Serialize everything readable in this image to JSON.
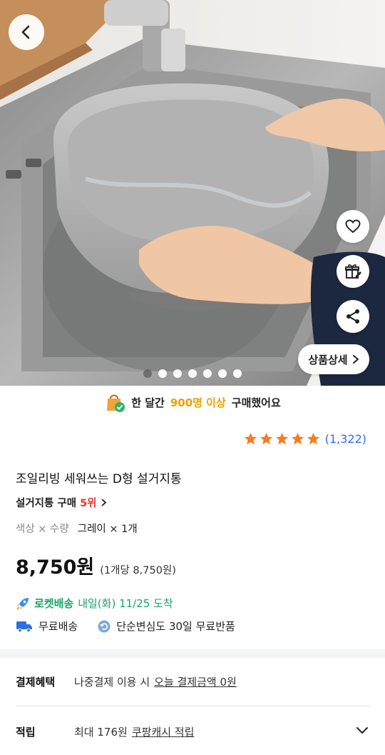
{
  "hero": {
    "total_images": 7,
    "active_index": 0,
    "detail_label": "상품상세"
  },
  "icons": {
    "back": "chevron-left-icon",
    "wishlist": "heart-icon",
    "gift": "gift-icon",
    "share": "share-icon",
    "detail": "chevron-right-icon"
  },
  "banner": {
    "pre": "한 달간",
    "count": "900명 이상",
    "post": "구매했어요"
  },
  "rating": {
    "stars": 5,
    "count_label": "(1,322)",
    "star_color": "#f57c20"
  },
  "product": {
    "title": "조일리빙 세워쓰는 D형 설거지통",
    "rank_label": "설거지통 구매",
    "rank_value": "5위",
    "option_label": "색상 × 수량",
    "option_value": "그레이 × 1개",
    "price": "8,750원",
    "unit_price": "(1개당 8,750원)"
  },
  "delivery": {
    "rocket_label": "로켓배송",
    "eta": "내일(화) 11/25 도착",
    "free_shipping": "무료배송",
    "return_policy": "단순변심도 30일 무료반품"
  },
  "benefits": {
    "payment_key": "결제혜택",
    "payment_pre": "나중결제 이용 시",
    "payment_link": "오늘 결제금액 0원",
    "points_key": "적립",
    "points_pre": "최대 176원",
    "points_link": "쿠팡캐시 적립"
  },
  "colors": {
    "accent_yellow": "#e9a100",
    "rank_red": "#e9332b",
    "rocket_green": "#1aa36b",
    "link_blue": "#346aff"
  }
}
